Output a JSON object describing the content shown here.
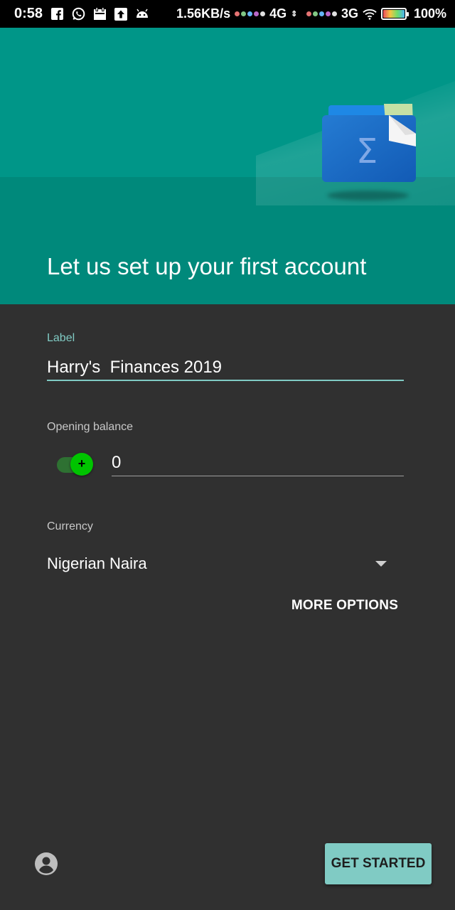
{
  "status_bar": {
    "time": "0:58",
    "network_speed": "1.56KB/s",
    "sim1_type": "4G",
    "sim2_type": "3G",
    "battery_text": "100%",
    "icons": [
      "facebook-icon",
      "whatsapp-icon",
      "calendar-icon",
      "upload-icon",
      "android-icon",
      "signal-dots-icon",
      "wifi-icon",
      "battery-icon"
    ]
  },
  "header": {
    "title": "Let us set up your first account",
    "colors": {
      "upper": "#009688",
      "lower": "#00897b"
    },
    "illustration": "wallet-sigma-icon"
  },
  "form": {
    "label_field": {
      "label": "Label",
      "value": "Harry's  Finances 2019"
    },
    "opening_balance": {
      "label": "Opening balance",
      "toggle_symbol": "+",
      "toggle_on": true,
      "value": "0"
    },
    "currency": {
      "label": "Currency",
      "value": "Nigerian Naira"
    },
    "more_options": "MORE OPTIONS"
  },
  "footer": {
    "get_started": "GET STARTED",
    "account_icon": "account-circle-icon"
  },
  "colors": {
    "accent": "#80cbc4",
    "background": "#303030",
    "toggle_thumb": "#00c400"
  }
}
